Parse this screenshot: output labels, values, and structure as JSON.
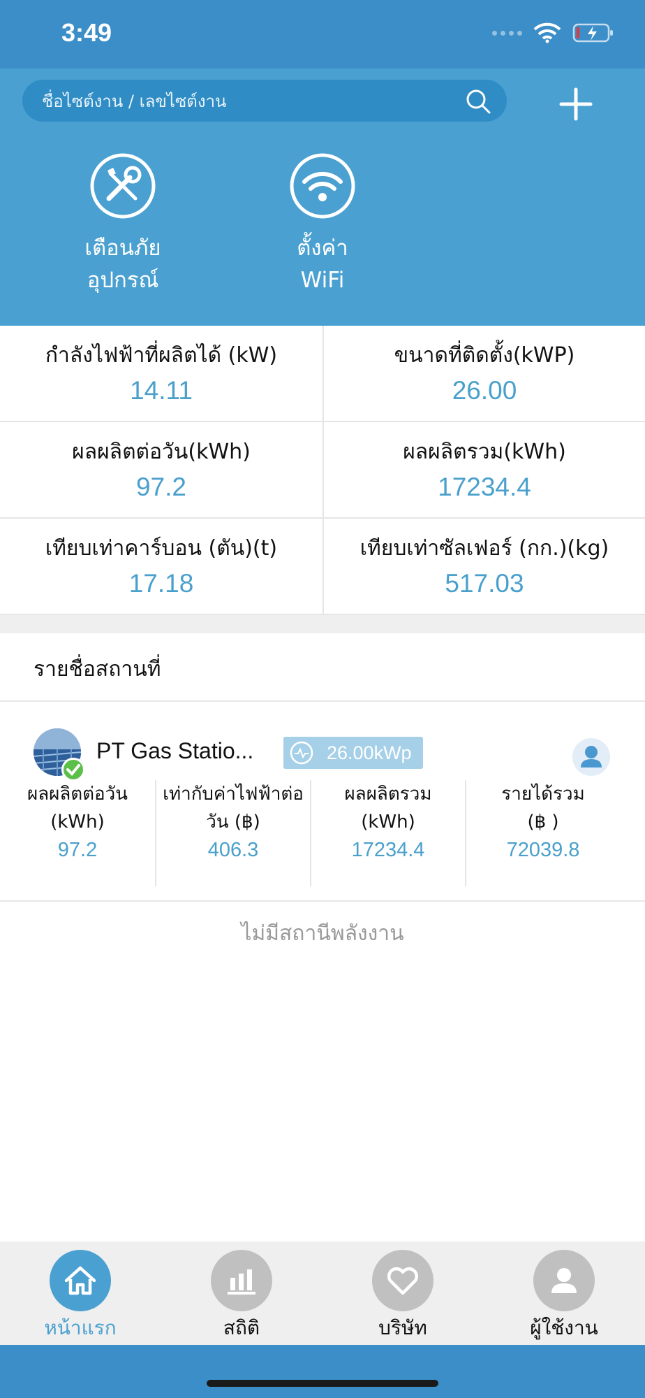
{
  "status_bar": {
    "time": "3:49"
  },
  "search": {
    "placeholder": "ชื่อไซต์งาน / เลขไซต์งาน"
  },
  "quick_actions": [
    {
      "icon": "tools-icon",
      "label_line1": "เตือนภัย",
      "label_line2": "อุปกรณ์"
    },
    {
      "icon": "wifi-icon",
      "label_line1": "ตั้งค่า",
      "label_line2": "WiFi"
    }
  ],
  "stats": [
    {
      "label": "กำลังไฟฟ้าที่ผลิตได้ (kW)",
      "value": "14.11"
    },
    {
      "label": "ขนาดที่ติดตั้ง(kWP)",
      "value": "26.00"
    },
    {
      "label": "ผลผลิตต่อวัน(kWh)",
      "value": "97.2"
    },
    {
      "label": "ผลผลิตรวม(kWh)",
      "value": "17234.4"
    },
    {
      "label": "เทียบเท่าคาร์บอน (ตัน)(t)",
      "value": "17.18"
    },
    {
      "label": "เทียบเท่าซัลเฟอร์ (กก.)(kg)",
      "value": "517.03"
    }
  ],
  "section": {
    "title": "รายชื่อสถานที่"
  },
  "station": {
    "name": "PT Gas Statio...",
    "capacity": "26.00kWp",
    "metrics": [
      {
        "label_line1": "ผลผลิตต่อวัน",
        "label_line2": "(kWh)",
        "value": "97.2"
      },
      {
        "label_line1": "เท่ากับค่าไฟฟ้าต่อ",
        "label_line2": "วัน (฿)",
        "value": "406.3"
      },
      {
        "label_line1": "ผลผลิตรวม",
        "label_line2": "(kWh)",
        "value": "17234.4"
      },
      {
        "label_line1": "รายได้รวม",
        "label_line2": "(฿ )",
        "value": "72039.8"
      }
    ]
  },
  "empty_note": "ไม่มีสถานีพลังงาน",
  "tabs": [
    {
      "label": "หน้าแรก",
      "icon": "home-icon",
      "active": true
    },
    {
      "label": "สถิติ",
      "icon": "bar-chart-icon",
      "active": false
    },
    {
      "label": "บริษัท",
      "icon": "heart-icon",
      "active": false
    },
    {
      "label": "ผู้ใช้งาน",
      "icon": "user-icon",
      "active": false
    }
  ],
  "colors": {
    "primary": "#4aa0d0",
    "status_bar": "#3b8ec8",
    "value_text": "#4aa0cc",
    "online": "#5bbf4a"
  }
}
